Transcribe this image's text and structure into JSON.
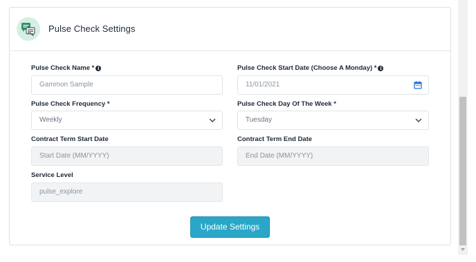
{
  "header": {
    "title": "Pulse Check Settings",
    "icon": "chat-bubbles-icon"
  },
  "form": {
    "name": {
      "label": "Pulse Check Name *",
      "value": "Gammon Sample",
      "has_info": true
    },
    "start_date": {
      "label": "Pulse Check Start Date (Choose A Monday) *",
      "value": "11/01/2021",
      "has_info": true
    },
    "frequency": {
      "label": "Pulse Check Frequency *",
      "value": "Weekly"
    },
    "day_of_week": {
      "label": "Pulse Check Day Of The Week *",
      "value": "Tuesday"
    },
    "contract_start": {
      "label": "Contract Term Start Date",
      "placeholder": "Start Date (MM/YYYY)"
    },
    "contract_end": {
      "label": "Contract Term End Date",
      "placeholder": "End Date (MM/YYYY)"
    },
    "service_level": {
      "label": "Service Level",
      "value": "pulse_explore"
    }
  },
  "actions": {
    "update_label": "Update Settings"
  },
  "colors": {
    "accent": "#2aa7c8",
    "icon_bg": "#d5efe2",
    "icon_green": "#2f8f6b",
    "calendar_blue": "#2b6fd6"
  }
}
